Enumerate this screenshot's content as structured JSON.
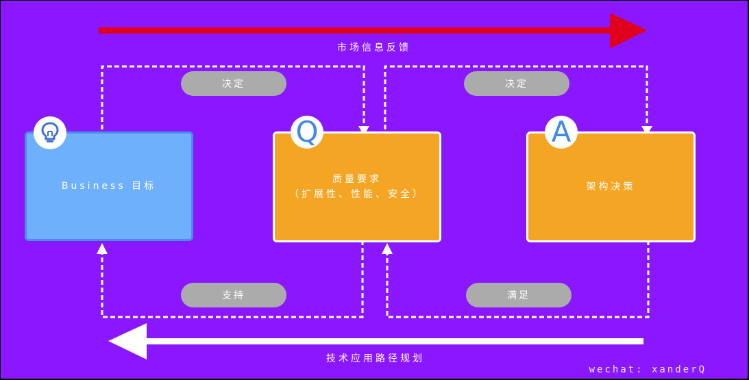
{
  "top_arrow": {
    "label": "市场信息反馈",
    "color": "#e0001b"
  },
  "bottom_arrow": {
    "label": "技术应用路径规划",
    "color": "#ffffff"
  },
  "boxes": {
    "business": {
      "label": "Business 目标",
      "icon": "lightbulb-icon",
      "color": "#6eb0fb"
    },
    "quality": {
      "line1": "质量要求",
      "line2": "（扩展性、性能、安全）",
      "badge": "Q",
      "color": "#f3a523"
    },
    "architecture": {
      "label": "架构决策",
      "badge": "A",
      "color": "#f3a523"
    }
  },
  "pills": {
    "decide_left": "决定",
    "decide_right": "决定",
    "support": "支持",
    "satisfy": "满足"
  },
  "watermark": "wechat: xanderQ"
}
